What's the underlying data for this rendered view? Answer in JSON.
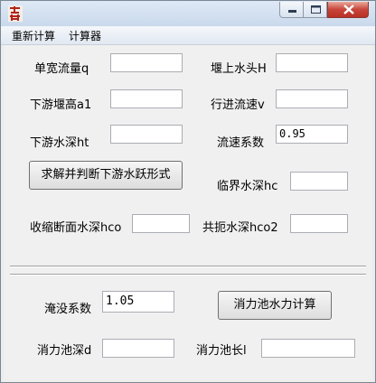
{
  "menu": {
    "items": [
      "重新计算",
      "计算器"
    ]
  },
  "upper": {
    "unit_flow_label": "单宽流量q",
    "unit_flow_value": "",
    "weir_head_label": "堰上水头H",
    "weir_head_value": "",
    "downstream_weir_height_label": "下游堰高a1",
    "downstream_weir_height_value": "",
    "approach_velocity_label": "行进流速v",
    "approach_velocity_value": "",
    "downstream_depth_label": "下游水深ht",
    "downstream_depth_value": "",
    "velocity_coef_label": "流速系数",
    "velocity_coef_value": "0.95",
    "solve_button": "求解并判断下游水跃形式",
    "critical_depth_label": "临界水深hc",
    "critical_depth_value": "",
    "contracted_depth_label": "收缩断面水深hco",
    "contracted_depth_value": "",
    "conjugate_depth_label": "共扼水深hco2",
    "conjugate_depth_value": ""
  },
  "lower": {
    "submergence_label": "淹没系数",
    "submergence_value": "1.05",
    "calc_button": "消力池水力计算",
    "basin_depth_label": "消力池深d",
    "basin_depth_value": "",
    "basin_length_label": "消力池长l",
    "basin_length_value": ""
  },
  "colors": {
    "accent": "#c0392b",
    "close_button": "#c8453a",
    "window_bg": "#f0f0f0"
  }
}
